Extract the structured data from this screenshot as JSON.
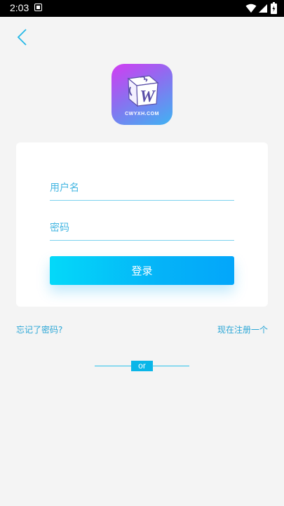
{
  "status_bar": {
    "time": "2:03",
    "icons": [
      "notification-icon",
      "wifi-icon",
      "signal-icon",
      "battery-icon"
    ]
  },
  "nav": {
    "back_icon": "chevron-left-icon"
  },
  "logo": {
    "text": "CWYXH.COM",
    "letter": "W"
  },
  "form": {
    "username_placeholder": "用户名",
    "password_placeholder": "密码",
    "login_label": "登录"
  },
  "links": {
    "forgot_password": "忘记了密码?",
    "register": "现在注册一个"
  },
  "divider": {
    "text": "or"
  },
  "colors": {
    "accent": "#03b6f5",
    "link": "#2aa6d6",
    "background": "#f4f4f4"
  }
}
